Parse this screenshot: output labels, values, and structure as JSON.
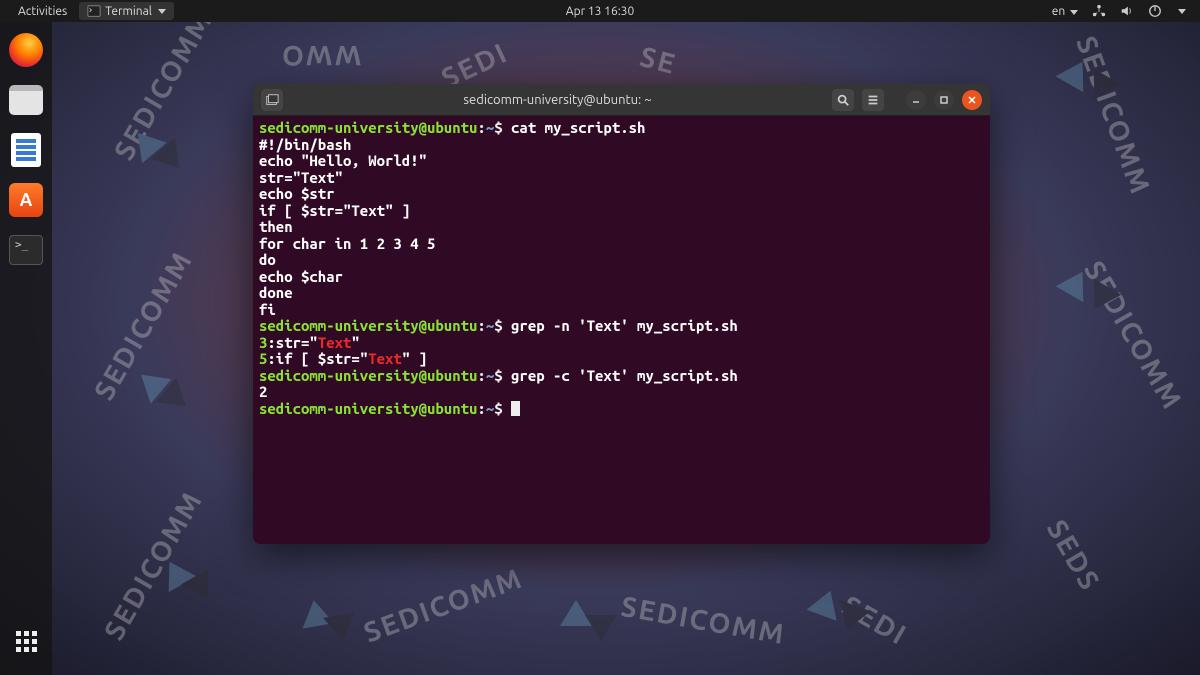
{
  "topbar": {
    "activities": "Activities",
    "app_menu": "Terminal",
    "datetime": "Apr 13  16:30",
    "lang": "en"
  },
  "dock": {
    "items": [
      "firefox",
      "files",
      "document",
      "software",
      "terminal"
    ]
  },
  "term": {
    "title": "sedicomm-university@ubuntu: ~",
    "prompt_user": "sedicomm-university@ubuntu",
    "prompt_sep": ":",
    "prompt_path": "~",
    "prompt_sym": "$ ",
    "cmd1": "cat my_script.sh",
    "script": [
      "#!/bin/bash",
      "echo \"Hello, World!\"",
      "str=\"Text\"",
      "echo $str",
      "if [ $str=\"Text\" ]",
      "then",
      "for char in 1 2 3 4 5",
      "do",
      "echo $char",
      "done",
      "fi"
    ],
    "cmd2": "grep -n 'Text' my_script.sh",
    "grep_n": [
      {
        "num": "3",
        "pre": ":str=\"",
        "match": "Text",
        "post": "\""
      },
      {
        "num": "5",
        "pre": ":if [ $str=\"",
        "match": "Text",
        "post": "\" ]"
      }
    ],
    "cmd3": "grep -c 'Text' my_script.sh",
    "count_out": "2"
  }
}
